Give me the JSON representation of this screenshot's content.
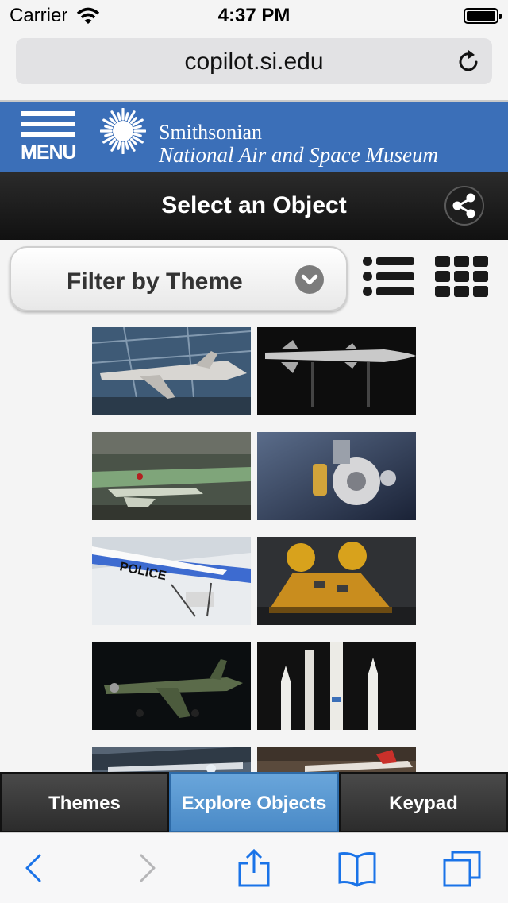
{
  "status_bar": {
    "carrier": "Carrier",
    "time": "4:37 PM"
  },
  "browser": {
    "url": "copilot.si.edu"
  },
  "header": {
    "menu_label": "MENU",
    "brand_line1": "Smithsonian",
    "brand_line2": "National Air and Space Museum"
  },
  "page": {
    "title": "Select an Object"
  },
  "filter": {
    "label": "Filter by Theme"
  },
  "tabs": [
    {
      "label": "Themes"
    },
    {
      "label": "Explore Objects"
    },
    {
      "label": "Keypad"
    }
  ],
  "colors": {
    "header_blue": "#3b6fb8",
    "active_tab": "#5b9bd5",
    "ios_blue": "#1a73e8"
  },
  "icons": [
    "wifi-icon",
    "battery-icon",
    "reload-icon",
    "menu-icon",
    "smithsonian-sun-logo",
    "share-icon",
    "chevron-down-icon",
    "list-view-icon",
    "grid-view-icon",
    "back-icon",
    "forward-icon",
    "share-sheet-icon",
    "bookmarks-icon",
    "tabs-icon"
  ]
}
